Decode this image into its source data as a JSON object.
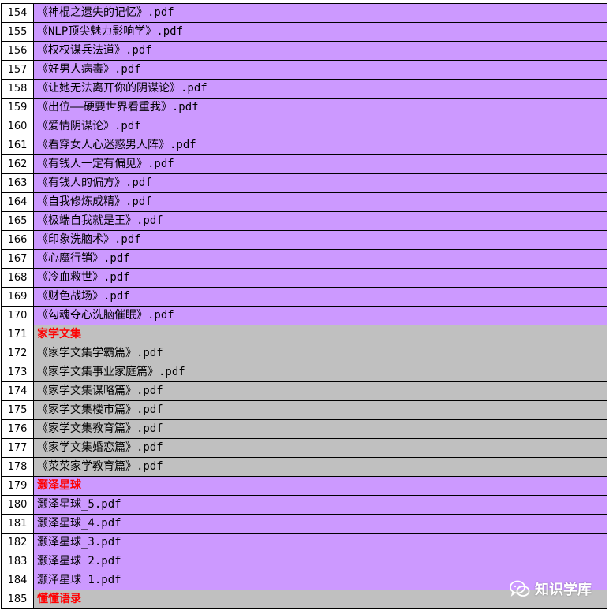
{
  "colors": {
    "purple": "#cc99ff",
    "gray": "#c0c0c0",
    "section_text": "#ff0000"
  },
  "rows": [
    {
      "num": "154",
      "text": "《神棍之遗失的记忆》.pdf",
      "style": "purple"
    },
    {
      "num": "155",
      "text": "《NLP顶尖魅力影响学》.pdf",
      "style": "purple"
    },
    {
      "num": "156",
      "text": "《权权谋兵法道》.pdf",
      "style": "purple"
    },
    {
      "num": "157",
      "text": "《好男人病毒》.pdf",
      "style": "purple"
    },
    {
      "num": "158",
      "text": "《让她无法离开你的阴谋论》.pdf",
      "style": "purple"
    },
    {
      "num": "159",
      "text": "《出位——硬要世界看重我》.pdf",
      "style": "purple"
    },
    {
      "num": "160",
      "text": "《爱情阴谋论》.pdf",
      "style": "purple"
    },
    {
      "num": "161",
      "text": "《看穿女人心迷惑男人阵》.pdf",
      "style": "purple"
    },
    {
      "num": "162",
      "text": "《有钱人一定有偏见》.pdf",
      "style": "purple"
    },
    {
      "num": "163",
      "text": "《有钱人的偏方》.pdf",
      "style": "purple"
    },
    {
      "num": "164",
      "text": "《自我修炼成精》.pdf",
      "style": "purple"
    },
    {
      "num": "165",
      "text": "《极端自我就是王》.pdf",
      "style": "purple"
    },
    {
      "num": "166",
      "text": "《印象洗脑术》.pdf",
      "style": "purple"
    },
    {
      "num": "167",
      "text": "《心魔行销》.pdf",
      "style": "purple"
    },
    {
      "num": "168",
      "text": "《冷血救世》.pdf",
      "style": "purple"
    },
    {
      "num": "169",
      "text": "《财色战场》.pdf",
      "style": "purple"
    },
    {
      "num": "170",
      "text": "《勾魂夺心洗脑催眠》.pdf",
      "style": "purple"
    },
    {
      "num": "171",
      "text": "家学文集",
      "style": "gray",
      "section": true
    },
    {
      "num": "172",
      "text": "《家学文集学霸篇》.pdf",
      "style": "gray"
    },
    {
      "num": "173",
      "text": "《家学文集事业家庭篇》.pdf",
      "style": "gray"
    },
    {
      "num": "174",
      "text": "《家学文集谋略篇》.pdf",
      "style": "gray"
    },
    {
      "num": "175",
      "text": "《家学文集楼市篇》.pdf",
      "style": "gray"
    },
    {
      "num": "176",
      "text": "《家学文集教育篇》.pdf",
      "style": "gray"
    },
    {
      "num": "177",
      "text": "《家学文集婚恋篇》.pdf",
      "style": "gray"
    },
    {
      "num": "178",
      "text": "《菜菜家学教育篇》.pdf",
      "style": "gray"
    },
    {
      "num": "179",
      "text": "灏泽星球",
      "style": "purple",
      "section": true
    },
    {
      "num": "180",
      "text": "灏泽星球_5.pdf",
      "style": "purple"
    },
    {
      "num": "181",
      "text": "灏泽星球_4.pdf",
      "style": "purple"
    },
    {
      "num": "182",
      "text": "灏泽星球_3.pdf",
      "style": "purple"
    },
    {
      "num": "183",
      "text": "灏泽星球_2.pdf",
      "style": "purple"
    },
    {
      "num": "184",
      "text": "灏泽星球_1.pdf",
      "style": "purple"
    },
    {
      "num": "185",
      "text": "懂懂语录",
      "style": "gray",
      "section": true
    }
  ],
  "watermark": {
    "icon": "wechat-icon",
    "text": "知识学库"
  }
}
